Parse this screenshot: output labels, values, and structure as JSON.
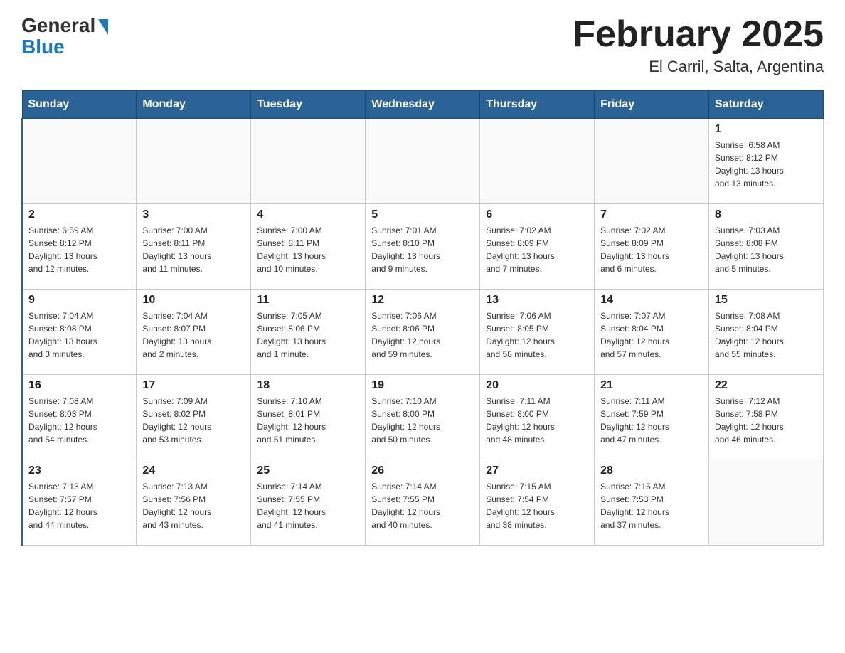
{
  "header": {
    "logo_general": "General",
    "logo_blue": "Blue",
    "title": "February 2025",
    "subtitle": "El Carril, Salta, Argentina"
  },
  "days_of_week": [
    "Sunday",
    "Monday",
    "Tuesday",
    "Wednesday",
    "Thursday",
    "Friday",
    "Saturday"
  ],
  "weeks": [
    [
      {
        "day": "",
        "info": ""
      },
      {
        "day": "",
        "info": ""
      },
      {
        "day": "",
        "info": ""
      },
      {
        "day": "",
        "info": ""
      },
      {
        "day": "",
        "info": ""
      },
      {
        "day": "",
        "info": ""
      },
      {
        "day": "1",
        "info": "Sunrise: 6:58 AM\nSunset: 8:12 PM\nDaylight: 13 hours\nand 13 minutes."
      }
    ],
    [
      {
        "day": "2",
        "info": "Sunrise: 6:59 AM\nSunset: 8:12 PM\nDaylight: 13 hours\nand 12 minutes."
      },
      {
        "day": "3",
        "info": "Sunrise: 7:00 AM\nSunset: 8:11 PM\nDaylight: 13 hours\nand 11 minutes."
      },
      {
        "day": "4",
        "info": "Sunrise: 7:00 AM\nSunset: 8:11 PM\nDaylight: 13 hours\nand 10 minutes."
      },
      {
        "day": "5",
        "info": "Sunrise: 7:01 AM\nSunset: 8:10 PM\nDaylight: 13 hours\nand 9 minutes."
      },
      {
        "day": "6",
        "info": "Sunrise: 7:02 AM\nSunset: 8:09 PM\nDaylight: 13 hours\nand 7 minutes."
      },
      {
        "day": "7",
        "info": "Sunrise: 7:02 AM\nSunset: 8:09 PM\nDaylight: 13 hours\nand 6 minutes."
      },
      {
        "day": "8",
        "info": "Sunrise: 7:03 AM\nSunset: 8:08 PM\nDaylight: 13 hours\nand 5 minutes."
      }
    ],
    [
      {
        "day": "9",
        "info": "Sunrise: 7:04 AM\nSunset: 8:08 PM\nDaylight: 13 hours\nand 3 minutes."
      },
      {
        "day": "10",
        "info": "Sunrise: 7:04 AM\nSunset: 8:07 PM\nDaylight: 13 hours\nand 2 minutes."
      },
      {
        "day": "11",
        "info": "Sunrise: 7:05 AM\nSunset: 8:06 PM\nDaylight: 13 hours\nand 1 minute."
      },
      {
        "day": "12",
        "info": "Sunrise: 7:06 AM\nSunset: 8:06 PM\nDaylight: 12 hours\nand 59 minutes."
      },
      {
        "day": "13",
        "info": "Sunrise: 7:06 AM\nSunset: 8:05 PM\nDaylight: 12 hours\nand 58 minutes."
      },
      {
        "day": "14",
        "info": "Sunrise: 7:07 AM\nSunset: 8:04 PM\nDaylight: 12 hours\nand 57 minutes."
      },
      {
        "day": "15",
        "info": "Sunrise: 7:08 AM\nSunset: 8:04 PM\nDaylight: 12 hours\nand 55 minutes."
      }
    ],
    [
      {
        "day": "16",
        "info": "Sunrise: 7:08 AM\nSunset: 8:03 PM\nDaylight: 12 hours\nand 54 minutes."
      },
      {
        "day": "17",
        "info": "Sunrise: 7:09 AM\nSunset: 8:02 PM\nDaylight: 12 hours\nand 53 minutes."
      },
      {
        "day": "18",
        "info": "Sunrise: 7:10 AM\nSunset: 8:01 PM\nDaylight: 12 hours\nand 51 minutes."
      },
      {
        "day": "19",
        "info": "Sunrise: 7:10 AM\nSunset: 8:00 PM\nDaylight: 12 hours\nand 50 minutes."
      },
      {
        "day": "20",
        "info": "Sunrise: 7:11 AM\nSunset: 8:00 PM\nDaylight: 12 hours\nand 48 minutes."
      },
      {
        "day": "21",
        "info": "Sunrise: 7:11 AM\nSunset: 7:59 PM\nDaylight: 12 hours\nand 47 minutes."
      },
      {
        "day": "22",
        "info": "Sunrise: 7:12 AM\nSunset: 7:58 PM\nDaylight: 12 hours\nand 46 minutes."
      }
    ],
    [
      {
        "day": "23",
        "info": "Sunrise: 7:13 AM\nSunset: 7:57 PM\nDaylight: 12 hours\nand 44 minutes."
      },
      {
        "day": "24",
        "info": "Sunrise: 7:13 AM\nSunset: 7:56 PM\nDaylight: 12 hours\nand 43 minutes."
      },
      {
        "day": "25",
        "info": "Sunrise: 7:14 AM\nSunset: 7:55 PM\nDaylight: 12 hours\nand 41 minutes."
      },
      {
        "day": "26",
        "info": "Sunrise: 7:14 AM\nSunset: 7:55 PM\nDaylight: 12 hours\nand 40 minutes."
      },
      {
        "day": "27",
        "info": "Sunrise: 7:15 AM\nSunset: 7:54 PM\nDaylight: 12 hours\nand 38 minutes."
      },
      {
        "day": "28",
        "info": "Sunrise: 7:15 AM\nSunset: 7:53 PM\nDaylight: 12 hours\nand 37 minutes."
      },
      {
        "day": "",
        "info": ""
      }
    ]
  ]
}
